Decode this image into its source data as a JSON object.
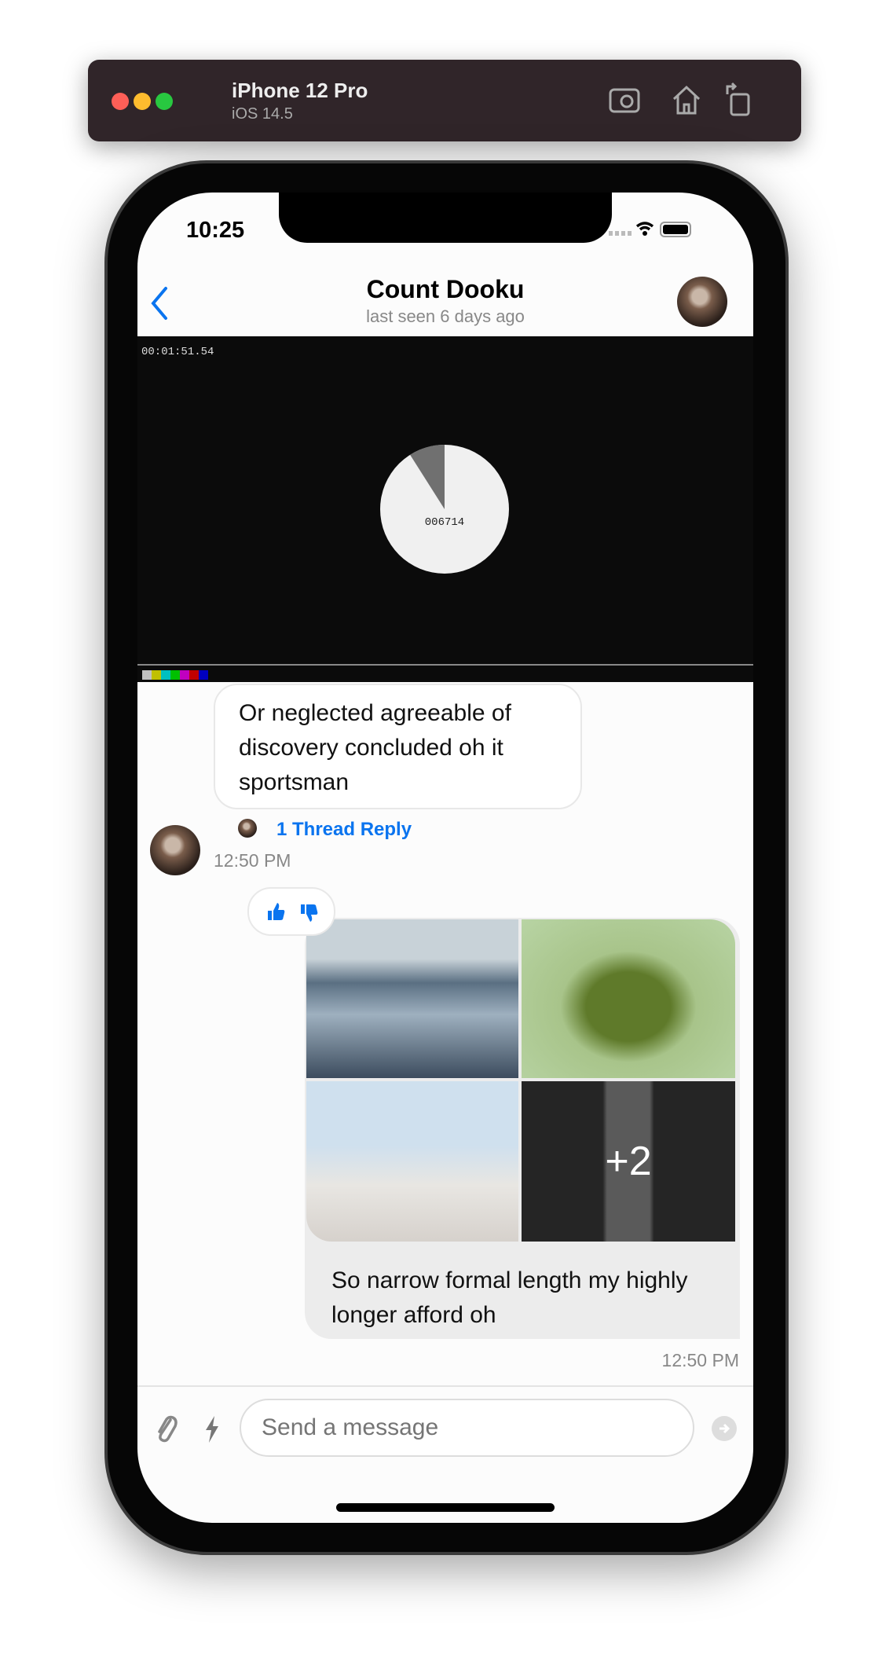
{
  "simulator": {
    "device": "iPhone 12 Pro",
    "os": "iOS 14.5",
    "icons": [
      "screenshot-icon",
      "home-icon",
      "rotate-icon"
    ]
  },
  "status_bar": {
    "time": "10:25"
  },
  "header": {
    "title": "Count Dooku",
    "subtitle": "last seen 6 days ago"
  },
  "video": {
    "timecode": "00:01:51.54",
    "counter": "006714",
    "progress_fraction": 0.09
  },
  "messages": [
    {
      "text": "Or neglected agreeable of discovery concluded oh it sportsman",
      "thread_reply": "1 Thread Reply",
      "time": "12:50 PM"
    },
    {
      "reactions": [
        "thumbs-up-icon",
        "thumbs-down-icon"
      ],
      "images_more": "+2",
      "text": "So narrow formal length my highly longer afford oh",
      "time": "12:50 PM"
    }
  ],
  "composer": {
    "placeholder": "Send a message"
  },
  "colors": {
    "accent": "#0a74ef",
    "toolbar": "#302529"
  }
}
